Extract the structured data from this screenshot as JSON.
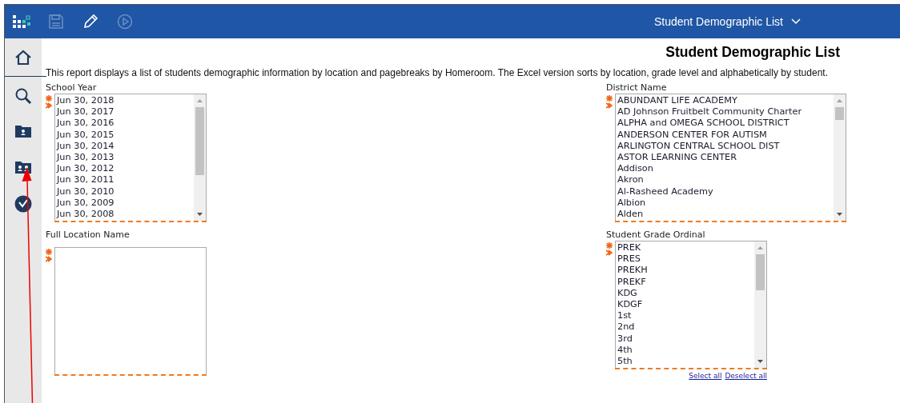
{
  "header": {
    "title": "Student Demographic List"
  },
  "page": {
    "heading": "Student Demographic List",
    "description": "This report displays a list of students demographic information by location and pagebreaks by Homeroom.  The Excel version sorts by location, grade level and alphabetically by student."
  },
  "filters": [
    {
      "label": "School Year",
      "required": true,
      "items": [
        "Jun 30, 2018",
        "Jun 30, 2017",
        "Jun 30, 2016",
        "Jun 30, 2015",
        "Jun 30, 2014",
        "Jun 30, 2013",
        "Jun 30, 2012",
        "Jun 30, 2011",
        "Jun 30, 2010",
        "Jun 30, 2009",
        "Jun 30, 2008"
      ]
    },
    {
      "label": "District Name",
      "required": true,
      "items": [
        "ABUNDANT LIFE ACADEMY",
        "AD Johnson Fruitbelt Community Charter",
        "ALPHA and OMEGA SCHOOL DISTRICT",
        "ANDERSON CENTER FOR AUTISM",
        "ARLINGTON CENTRAL SCHOOL DIST",
        "ASTOR LEARNING CENTER",
        "Addison",
        "Akron",
        "Al-Rasheed Academy",
        "Albion",
        "Alden"
      ]
    },
    {
      "label": "Full Location Name",
      "required": true
    },
    {
      "label": "Student Grade Ordinal",
      "required": true,
      "items": [
        "PREK",
        "PRES",
        "PREKH",
        "PREKF",
        "KDG",
        "KDGF",
        "1st",
        "2nd",
        "3rd",
        "4th",
        "5th"
      ],
      "links": [
        "Select all",
        "Deselect all"
      ]
    }
  ]
}
